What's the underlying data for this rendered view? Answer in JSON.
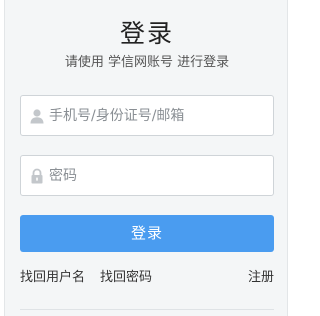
{
  "login_form": {
    "title": "登录",
    "subtitle_prefix": "请使用 ",
    "subtitle_account": "学信网账号",
    "subtitle_suffix": " 进行登录",
    "username": {
      "value": "",
      "placeholder": "手机号/身份证号/邮箱",
      "icon": "user-icon"
    },
    "password": {
      "value": "",
      "placeholder": "密码",
      "icon": "lock-icon"
    },
    "submit_label": "登录",
    "links": {
      "find_username": "找回用户名",
      "find_password": "找回密码",
      "register": "注册"
    }
  },
  "colors": {
    "panel_background": "#f4f6f7",
    "primary_button": "#4a9cf0",
    "input_border": "#cfd4d8",
    "icon_gray": "#c3c7cb"
  }
}
